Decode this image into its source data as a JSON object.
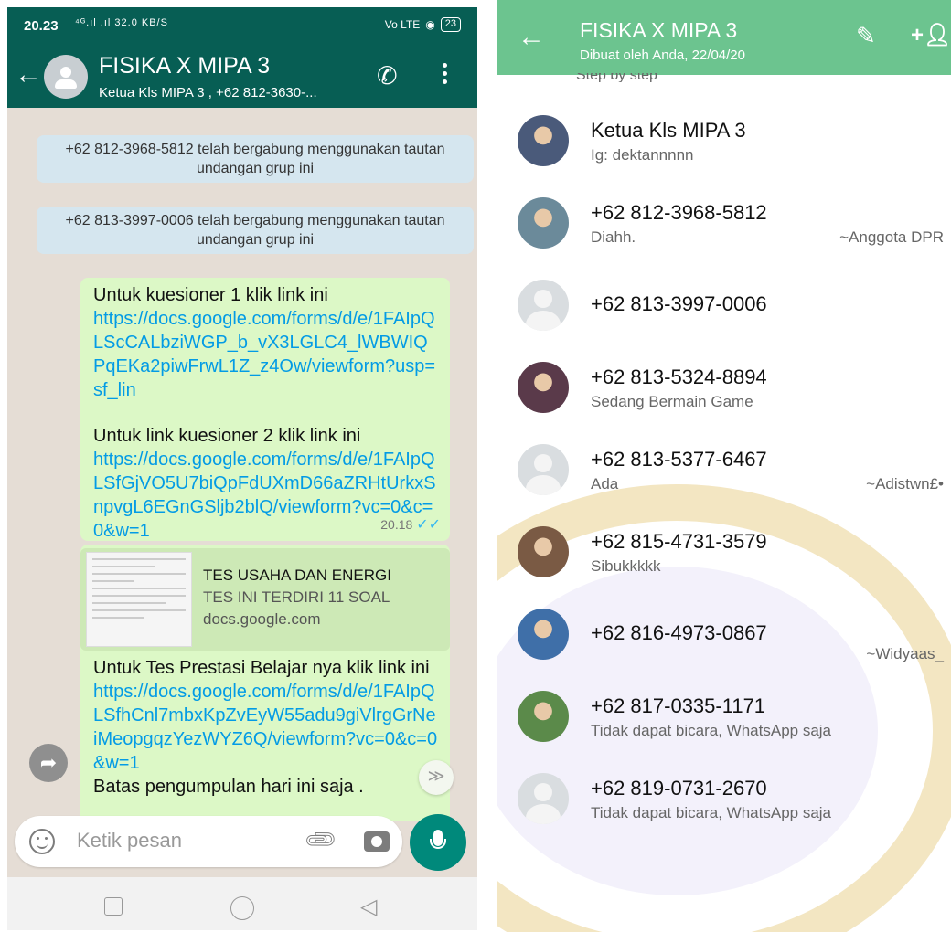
{
  "left": {
    "status": {
      "time": "20.23",
      "signal": "⁴ᴳ.ıl .ıl 32.0 KB/S",
      "network": "Vo LTE",
      "battery": "23"
    },
    "header": {
      "group_name": "FISIKA X MIPA 3",
      "subtitle": "Ketua Kls MIPA 3 , +62 812-3630-..."
    },
    "system_messages": [
      "+62 812-3968-5812 telah bergabung menggunakan tautan undangan grup ini",
      "+62 813-3997-0006 telah bergabung menggunakan tautan undangan grup ini"
    ],
    "msg1": {
      "text1": "Untuk kuesioner 1 klik link ini",
      "link1": "https://docs.google.com/forms/d/e/1FAIpQLScCALbziWGP_b_vX3LGLC4_lWBWIQPqEKa2piwFrwL1Z_z4Ow/viewform?usp=sf_lin",
      "text2": "Untuk link kuesioner 2 klik link ini",
      "link2": "https://docs.google.com/forms/d/e/1FAIpQLSfGjVO5U7biQpFdUXmD66aZRHtUrkxSnpvgL6EGnGSljb2blQ/viewform?vc=0&c=0&w=1",
      "time": "20.18",
      "ticks": "✓✓"
    },
    "msg2": {
      "preview_title": "TES USAHA DAN ENERGI",
      "preview_desc": "TES INI TERDIRI 11 SOAL",
      "preview_domain": "docs.google.com",
      "text": "Untuk  Tes Prestasi Belajar nya klik link ini",
      "link": "https://docs.google.com/forms/d/e/1FAIpQLSfhCnl7mbxKpZvEyW55adu9giVlrgGrNeiMeopgqzYezWYZ6Q/viewform?vc=0&c=0&w=1",
      "footer": "Batas pengumpulan hari ini saja ."
    },
    "input_placeholder": "Ketik pesan",
    "icons": {
      "back": "arrow-left",
      "call": "add-call",
      "menu": "more-vert",
      "forward": "forward",
      "scroll": "double-chevron-down",
      "emoji": "smiley",
      "attach": "paperclip",
      "camera": "camera",
      "mic": "microphone"
    }
  },
  "right": {
    "title": "FISIKA X MIPA 3",
    "subtitle": "Dibuat oleh Anda, 22/04/20",
    "peek_text": "Step by step",
    "colors": {
      "header": "#6cc48f",
      "left_header": "#075e54",
      "bubble": "#dcf8c6",
      "link": "#039be5"
    },
    "participants": [
      {
        "name": "Ketua Kls MIPA 3",
        "about": "Ig: dektannnnn",
        "pushname": "",
        "avatar": "photo-girl",
        "color": "#4a5a7a"
      },
      {
        "name": "+62 812-3968-5812",
        "about": "Diahh.",
        "pushname": "~Anggota DPR",
        "avatar": "photo-landscape",
        "color": "#6b8a9a"
      },
      {
        "name": "+62 813-3997-0006",
        "about": "",
        "pushname": "",
        "avatar": "default",
        "color": "#d9dde0"
      },
      {
        "name": "+62 813-5324-8894",
        "about": "Sedang Bermain Game",
        "pushname": "",
        "avatar": "photo-flowers",
        "color": "#5a3a4a"
      },
      {
        "name": "+62 813-5377-6467",
        "about": "Ada",
        "pushname": "~Adistwn£•",
        "avatar": "default",
        "color": "#d9dde0"
      },
      {
        "name": "+62 815-4731-3579",
        "about": "Sibukkkkk",
        "pushname": "",
        "avatar": "photo-girl2",
        "color": "#7a5a44"
      },
      {
        "name": "+62 816-4973-0867",
        "about": "",
        "pushname": "~Widyaas_",
        "avatar": "photo-boy",
        "color": "#3f6fa8"
      },
      {
        "name": "+62 817-0335-1171",
        "about": "Tidak dapat bicara, WhatsApp saja",
        "pushname": "",
        "avatar": "photo-field",
        "color": "#5b8a4a"
      },
      {
        "name": "+62 819-0731-2670",
        "about": "Tidak dapat bicara, WhatsApp saja",
        "pushname": "",
        "avatar": "default",
        "color": "#d9dde0"
      }
    ]
  }
}
